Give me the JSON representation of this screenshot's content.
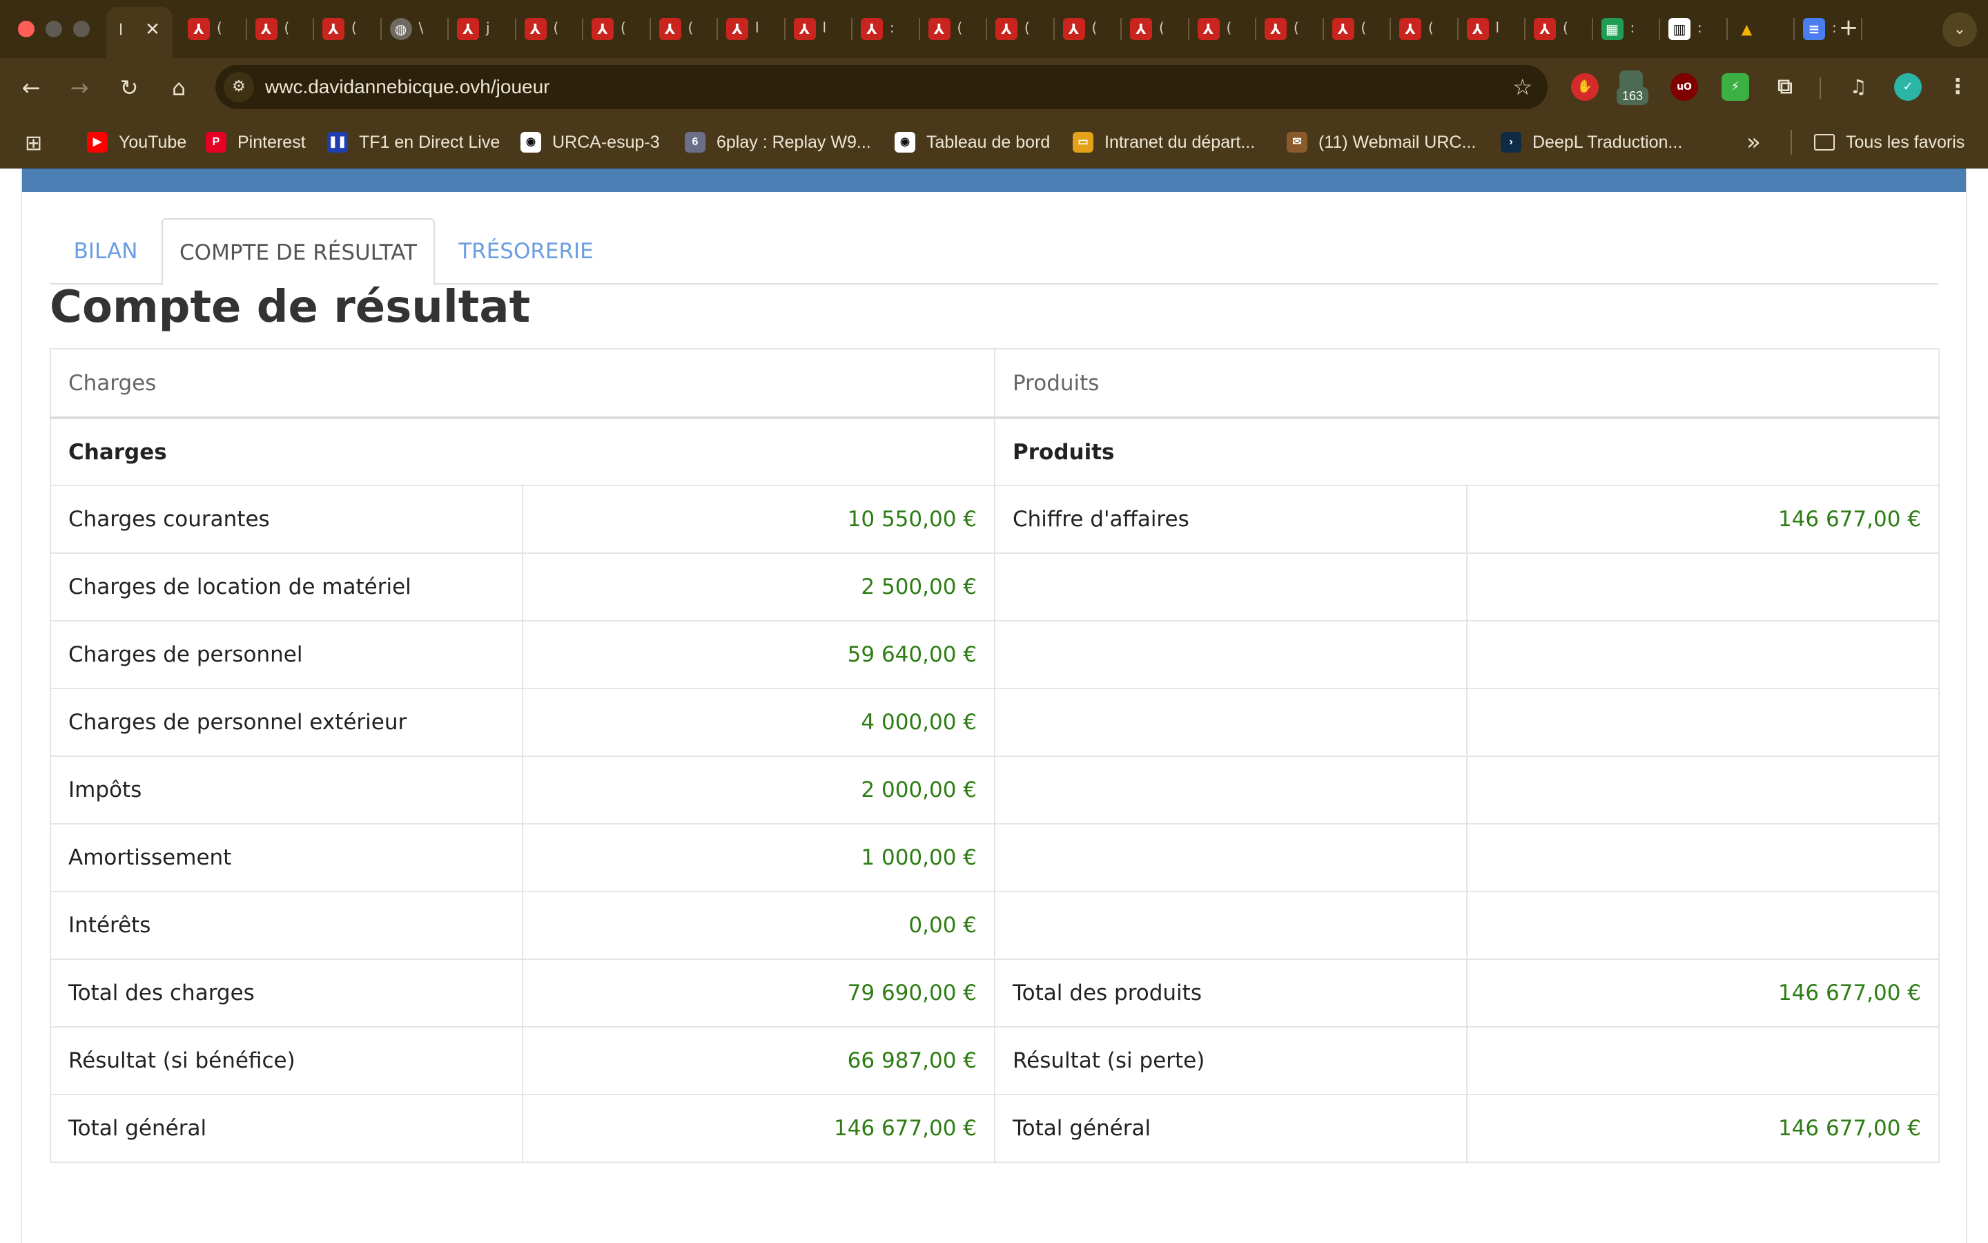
{
  "browser": {
    "active_tab_title": "l",
    "tabs": [
      {
        "icon": "pdf-icon",
        "title": "("
      },
      {
        "icon": "pdf-icon",
        "title": "("
      },
      {
        "icon": "pdf-icon",
        "title": "("
      },
      {
        "icon": "globe-icon",
        "title": "\\"
      },
      {
        "icon": "pdf-icon",
        "title": "j"
      },
      {
        "icon": "pdf-icon",
        "title": "("
      },
      {
        "icon": "pdf-icon",
        "title": "("
      },
      {
        "icon": "pdf-icon",
        "title": "("
      },
      {
        "icon": "pdf-icon",
        "title": "l"
      },
      {
        "icon": "pdf-icon",
        "title": "l"
      },
      {
        "icon": "pdf-icon",
        "title": ":"
      },
      {
        "icon": "pdf-icon",
        "title": "("
      },
      {
        "icon": "pdf-icon",
        "title": "("
      },
      {
        "icon": "pdf-icon",
        "title": "("
      },
      {
        "icon": "pdf-icon",
        "title": "("
      },
      {
        "icon": "pdf-icon",
        "title": "("
      },
      {
        "icon": "pdf-icon",
        "title": "("
      },
      {
        "icon": "pdf-icon",
        "title": "("
      },
      {
        "icon": "pdf-icon",
        "title": "("
      },
      {
        "icon": "pdf-icon",
        "title": "l"
      },
      {
        "icon": "pdf-icon",
        "title": "("
      },
      {
        "icon": "sheets-icon",
        "title": ":"
      },
      {
        "icon": "trello-icon",
        "title": ":"
      },
      {
        "icon": "drive-icon",
        "title": ""
      },
      {
        "icon": "docs-icon",
        "title": ":"
      }
    ],
    "url": "wwc.davidannebicque.ovh/joueur",
    "extension_badge": "163",
    "bookmarks": [
      {
        "icon": "youtube-icon",
        "label": "YouTube",
        "color": "#ff0000"
      },
      {
        "icon": "pinterest-icon",
        "label": "Pinterest",
        "color": "#e60023"
      },
      {
        "icon": "tf1-icon",
        "label": "TF1 en Direct Live",
        "color": "#1f3fb0"
      },
      {
        "icon": "eye-icon",
        "label": "URCA-esup-3",
        "color": "#ffffff"
      },
      {
        "icon": "6play-icon",
        "label": "6play : Replay W9...",
        "color": "#6b6f8a"
      },
      {
        "icon": "eye-icon",
        "label": "Tableau de bord",
        "color": "#ffffff"
      },
      {
        "icon": "intranet-icon",
        "label": "Intranet du départ...",
        "color": "#e3a21a"
      },
      {
        "icon": "mail-icon",
        "label": "(11) Webmail URC...",
        "color": "#8a5a2a"
      },
      {
        "icon": "deepl-icon",
        "label": "DeepL Traduction...",
        "color": "#0f2b46"
      }
    ],
    "all_bookmarks_label": "Tous les favoris"
  },
  "page": {
    "tabs": [
      {
        "label": "BILAN",
        "active": false
      },
      {
        "label": "COMPTE DE RÉSULTAT",
        "active": true
      },
      {
        "label": "TRÉSORERIE",
        "active": false
      }
    ],
    "title": "Compte de résultat",
    "table": {
      "header_left": "Charges",
      "header_right": "Produits",
      "section_left": "Charges",
      "section_right": "Produits",
      "rows": [
        {
          "left_label": "Charges courantes",
          "left_value": "10 550,00 €",
          "right_label": "Chiffre d'affaires",
          "right_value": "146 677,00 €"
        },
        {
          "left_label": "Charges de location de matériel",
          "left_value": "2 500,00 €",
          "right_label": "",
          "right_value": ""
        },
        {
          "left_label": "Charges de personnel",
          "left_value": "59 640,00 €",
          "right_label": "",
          "right_value": ""
        },
        {
          "left_label": "Charges de personnel extérieur",
          "left_value": "4 000,00 €",
          "right_label": "",
          "right_value": ""
        },
        {
          "left_label": "Impôts",
          "left_value": "2 000,00 €",
          "right_label": "",
          "right_value": ""
        },
        {
          "left_label": "Amortissement",
          "left_value": "1 000,00 €",
          "right_label": "",
          "right_value": ""
        },
        {
          "left_label": "Intérêts",
          "left_value": "0,00 €",
          "right_label": "",
          "right_value": ""
        },
        {
          "left_label": "Total des charges",
          "left_value": "79 690,00 €",
          "right_label": "Total des produits",
          "right_value": "146 677,00 €"
        },
        {
          "left_label": "Résultat (si bénéfice)",
          "left_value": "66 987,00 €",
          "right_label": "Résultat (si perte)",
          "right_value": ""
        },
        {
          "left_label": "Total général",
          "left_value": "146 677,00 €",
          "right_label": "Total général",
          "right_value": "146 677,00 €"
        }
      ]
    },
    "colors": {
      "amount": "#2e7d14",
      "link_tab": "#6a9ee0",
      "header_band": "#4b7eb3"
    }
  }
}
